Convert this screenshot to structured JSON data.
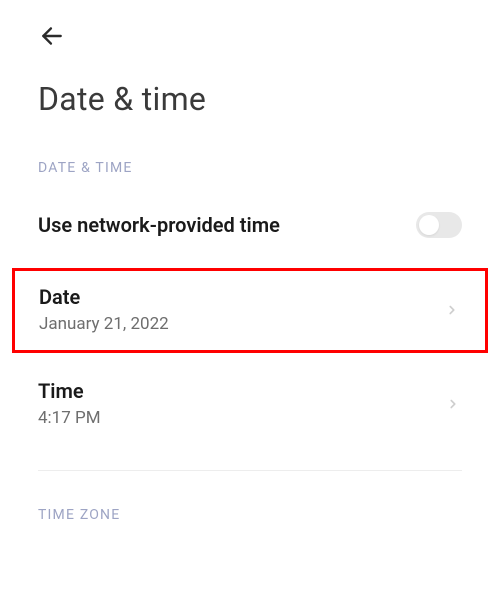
{
  "header": {
    "back_icon": "arrow-left"
  },
  "page": {
    "title": "Date & time"
  },
  "sections": {
    "date_time_header": "DATE & TIME",
    "time_zone_header": "TIME ZONE"
  },
  "rows": {
    "network_time": {
      "label": "Use network-provided time",
      "toggle_on": false
    },
    "date": {
      "label": "Date",
      "value": "January 21, 2022"
    },
    "time": {
      "label": "Time",
      "value": "4:17 PM"
    }
  }
}
